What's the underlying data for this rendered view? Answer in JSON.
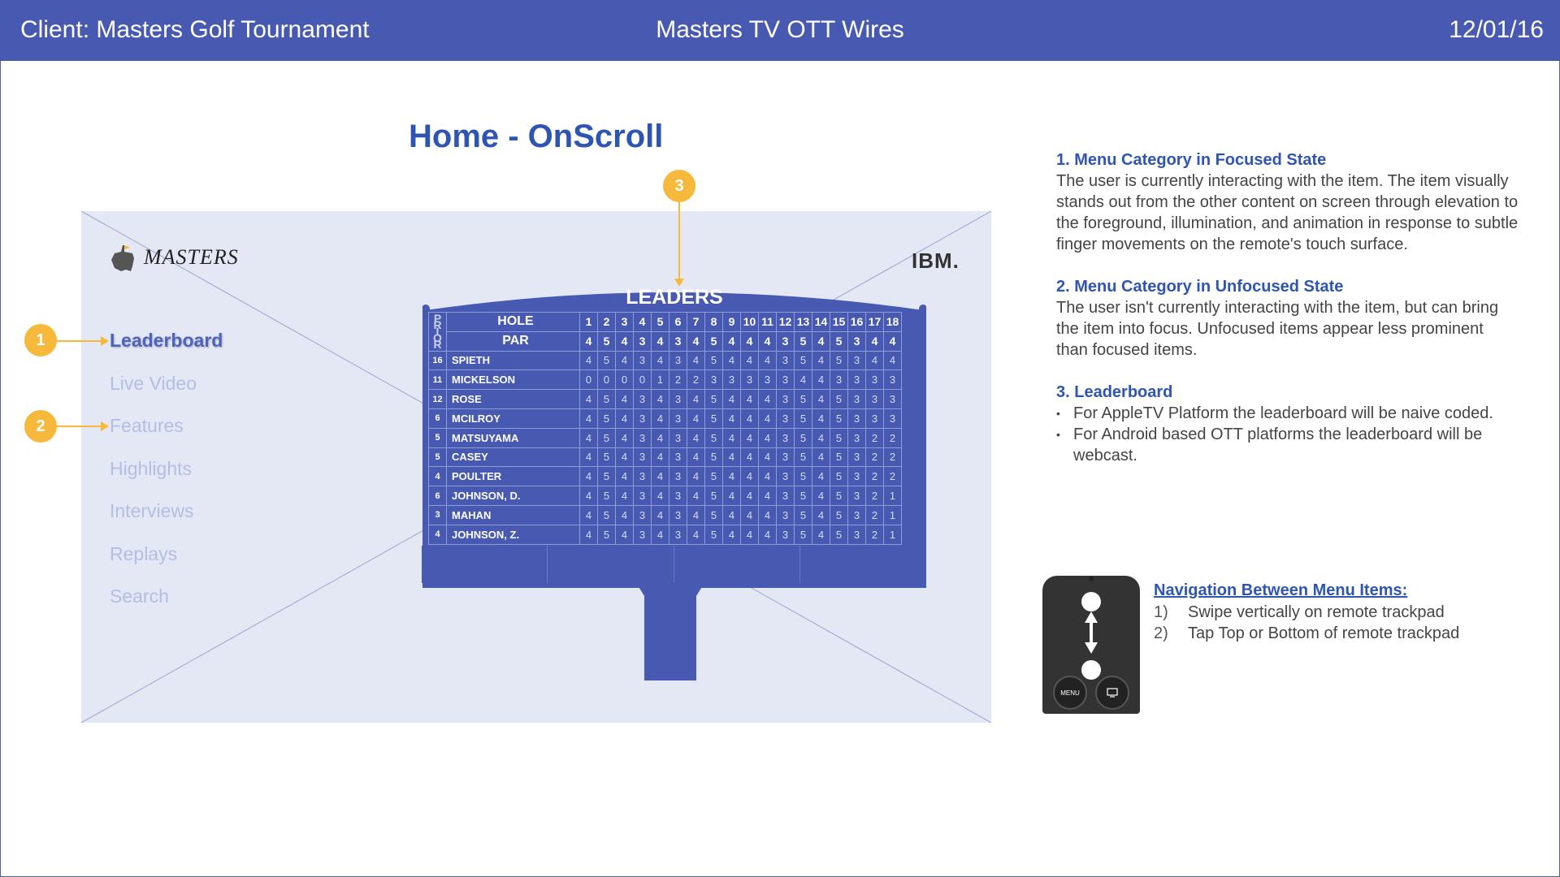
{
  "header": {
    "client": "Client: Masters Golf Tournament",
    "project": "Masters TV OTT Wires",
    "date": "12/01/16"
  },
  "page_title": "Home - OnScroll",
  "logos": {
    "masters": "MASTERS",
    "ibm": "IBM."
  },
  "menu": {
    "items": [
      {
        "label": "Leaderboard",
        "focused": true
      },
      {
        "label": "Live Video",
        "focused": false
      },
      {
        "label": "Features",
        "focused": false
      },
      {
        "label": "Highlights",
        "focused": false
      },
      {
        "label": "Interviews",
        "focused": false
      },
      {
        "label": "Replays",
        "focused": false
      },
      {
        "label": "Search",
        "focused": false
      }
    ]
  },
  "callouts": [
    "1",
    "2",
    "3"
  ],
  "leaderboard": {
    "title": "LEADERS",
    "prior_label": "PRIOR",
    "hole_label": "HOLE",
    "par_label": "PAR",
    "holes": [
      "1",
      "2",
      "3",
      "4",
      "5",
      "6",
      "7",
      "8",
      "9",
      "10",
      "11",
      "12",
      "13",
      "14",
      "15",
      "16",
      "17",
      "18"
    ],
    "par": [
      "4",
      "5",
      "4",
      "3",
      "4",
      "3",
      "4",
      "5",
      "4",
      "4",
      "4",
      "3",
      "5",
      "4",
      "5",
      "3",
      "4",
      "4"
    ],
    "players": [
      {
        "prior": "16",
        "name": "SPIETH",
        "scores": [
          "4",
          "5",
          "4",
          "3",
          "4",
          "3",
          "4",
          "5",
          "4",
          "4",
          "4",
          "3",
          "5",
          "4",
          "5",
          "3",
          "4",
          "4"
        ]
      },
      {
        "prior": "11",
        "name": "MICKELSON",
        "scores": [
          "0",
          "0",
          "0",
          "0",
          "1",
          "2",
          "2",
          "3",
          "3",
          "3",
          "3",
          "3",
          "4",
          "4",
          "3",
          "3",
          "3",
          "3"
        ]
      },
      {
        "prior": "12",
        "name": "ROSE",
        "scores": [
          "4",
          "5",
          "4",
          "3",
          "4",
          "3",
          "4",
          "5",
          "4",
          "4",
          "4",
          "3",
          "5",
          "4",
          "5",
          "3",
          "3",
          "3"
        ]
      },
      {
        "prior": "6",
        "name": "MCILROY",
        "scores": [
          "4",
          "5",
          "4",
          "3",
          "4",
          "3",
          "4",
          "5",
          "4",
          "4",
          "4",
          "3",
          "5",
          "4",
          "5",
          "3",
          "3",
          "3"
        ]
      },
      {
        "prior": "5",
        "name": "MATSUYAMA",
        "scores": [
          "4",
          "5",
          "4",
          "3",
          "4",
          "3",
          "4",
          "5",
          "4",
          "4",
          "4",
          "3",
          "5",
          "4",
          "5",
          "3",
          "2",
          "2"
        ]
      },
      {
        "prior": "5",
        "name": "CASEY",
        "scores": [
          "4",
          "5",
          "4",
          "3",
          "4",
          "3",
          "4",
          "5",
          "4",
          "4",
          "4",
          "3",
          "5",
          "4",
          "5",
          "3",
          "2",
          "2"
        ]
      },
      {
        "prior": "4",
        "name": "POULTER",
        "scores": [
          "4",
          "5",
          "4",
          "3",
          "4",
          "3",
          "4",
          "5",
          "4",
          "4",
          "4",
          "3",
          "5",
          "4",
          "5",
          "3",
          "2",
          "2"
        ]
      },
      {
        "prior": "6",
        "name": "JOHNSON, D.",
        "scores": [
          "4",
          "5",
          "4",
          "3",
          "4",
          "3",
          "4",
          "5",
          "4",
          "4",
          "4",
          "3",
          "5",
          "4",
          "5",
          "3",
          "2",
          "1"
        ]
      },
      {
        "prior": "3",
        "name": "MAHAN",
        "scores": [
          "4",
          "5",
          "4",
          "3",
          "4",
          "3",
          "4",
          "5",
          "4",
          "4",
          "4",
          "3",
          "5",
          "4",
          "5",
          "3",
          "2",
          "1"
        ]
      },
      {
        "prior": "4",
        "name": "JOHNSON, Z.",
        "scores": [
          "4",
          "5",
          "4",
          "3",
          "4",
          "3",
          "4",
          "5",
          "4",
          "4",
          "4",
          "3",
          "5",
          "4",
          "5",
          "3",
          "2",
          "1"
        ]
      }
    ]
  },
  "notes": [
    {
      "title": "1.  Menu Category in Focused State",
      "body": "The user is currently interacting with the item. The item visually stands out from the other content on screen through elevation to the foreground, illumination, and animation in response to subtle finger movements on the remote's touch surface."
    },
    {
      "title": "2. Menu Category in Unfocused State",
      "body": "The user isn't currently interacting with the item, but can bring the item into focus. Unfocused items appear less prominent than focused items."
    },
    {
      "title": "3. Leaderboard",
      "bullets": [
        "For AppleTV Platform the leaderboard will be naive coded.",
        "For Android based OTT platforms the leaderboard will be webcast."
      ]
    }
  ],
  "navigation": {
    "title": "Navigation Between Menu Items:",
    "steps": [
      {
        "index": "1)",
        "text": "Swipe vertically on remote trackpad"
      },
      {
        "index": "2)",
        "text": "Tap Top or Bottom of remote trackpad"
      }
    ],
    "remote_menu_label": "MENU"
  },
  "colors": {
    "header_bg": "#4759b0",
    "accent_blue": "#2f55b4",
    "callout_yellow": "#f6b93c",
    "wire_bg": "#e4e8f5",
    "unfocused_menu": "#b3bee6"
  }
}
